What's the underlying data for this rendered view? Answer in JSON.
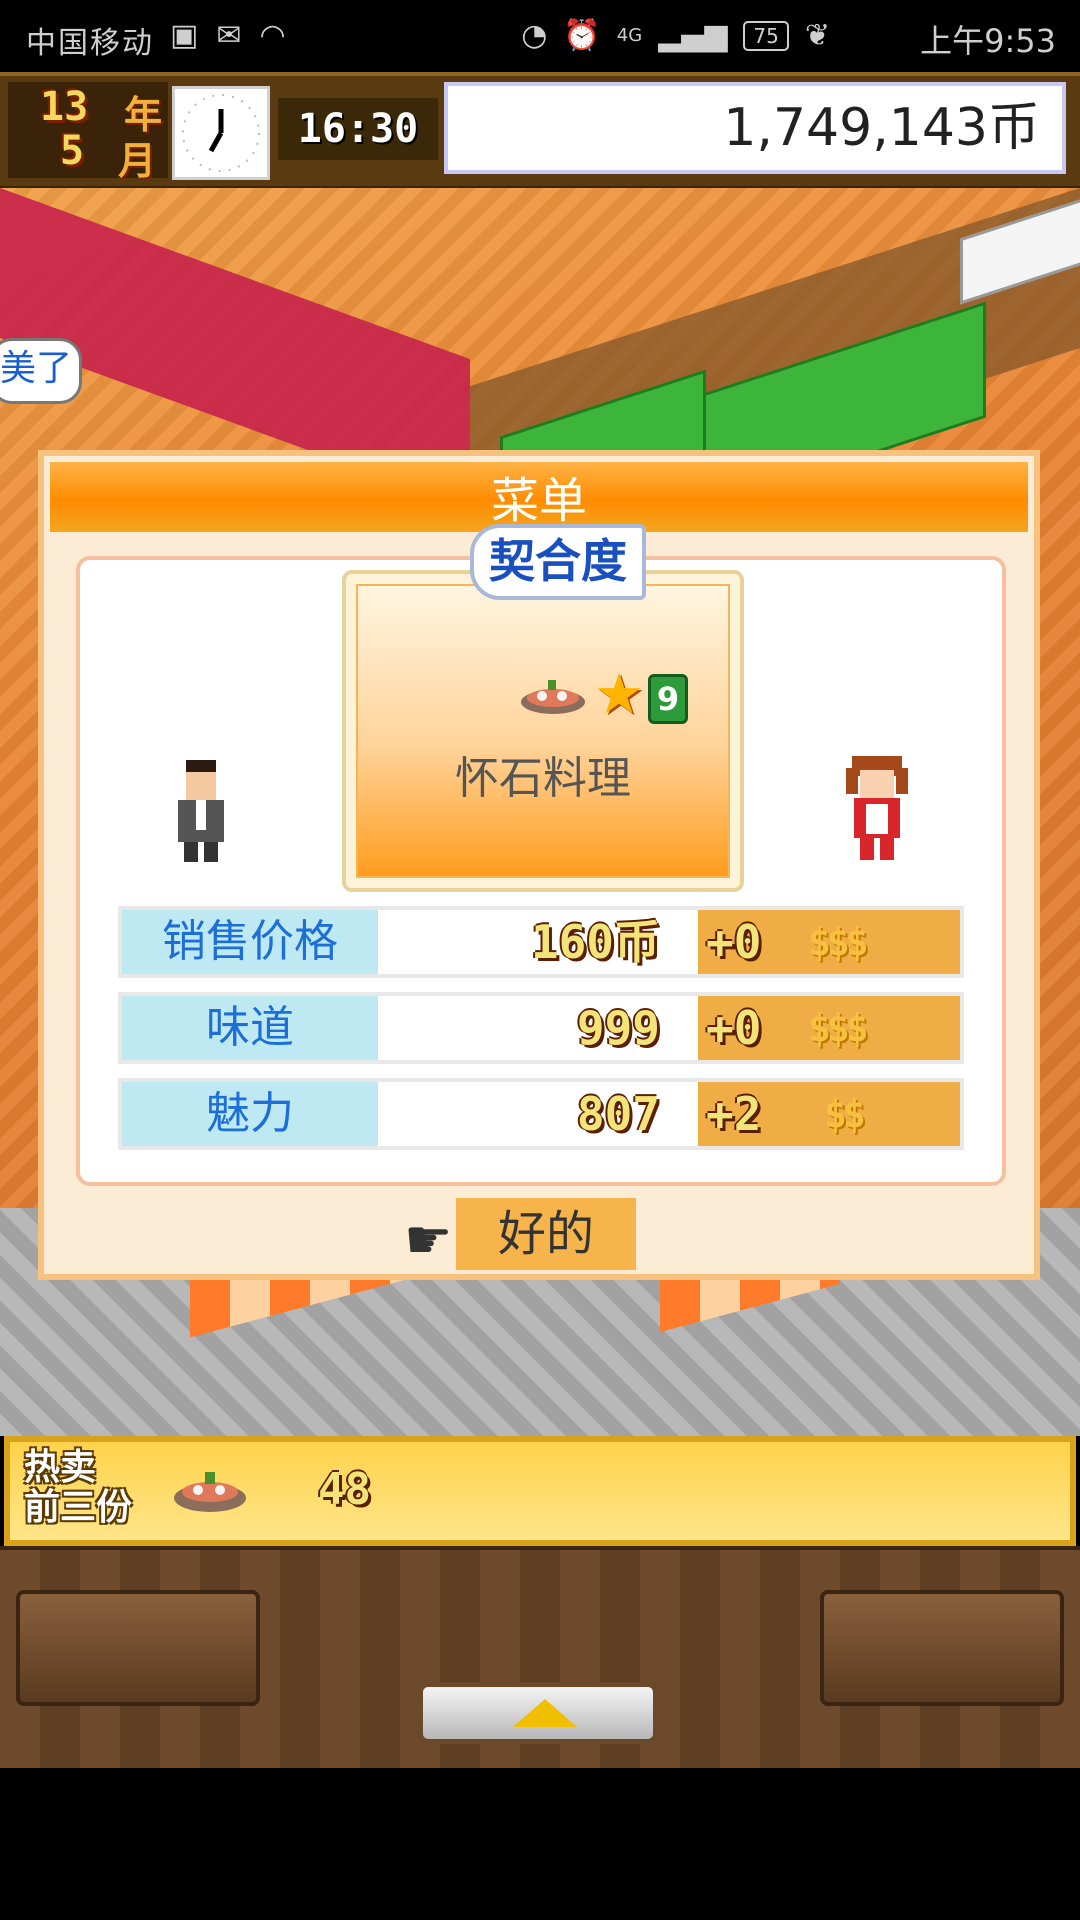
{
  "status_bar": {
    "carrier": "中国移动",
    "network": "4G",
    "battery": "75",
    "time": "上午9:53"
  },
  "top_bar": {
    "year_num": "13",
    "year_unit": "年",
    "month_num": "5",
    "month_unit": "月",
    "game_time": "16:30",
    "money": "1,749,143币"
  },
  "scene": {
    "speech_bubble": "美了"
  },
  "menu_dialog": {
    "title": "菜单",
    "compat_tag": "契合度",
    "dish": {
      "name": "怀石料理",
      "rank": "9"
    },
    "stats": [
      {
        "label": "销售价格",
        "value": "160币",
        "bonus": "+0",
        "coins": "$$$"
      },
      {
        "label": "味道",
        "value": "999",
        "bonus": "+0",
        "coins": "$$$"
      },
      {
        "label": "魅力",
        "value": "807",
        "bonus": "+2",
        "coins": "$$"
      }
    ],
    "ok_label": "好的"
  },
  "hot_sales": {
    "label_line1": "热卖",
    "label_line2": "前三份",
    "count": "48"
  }
}
